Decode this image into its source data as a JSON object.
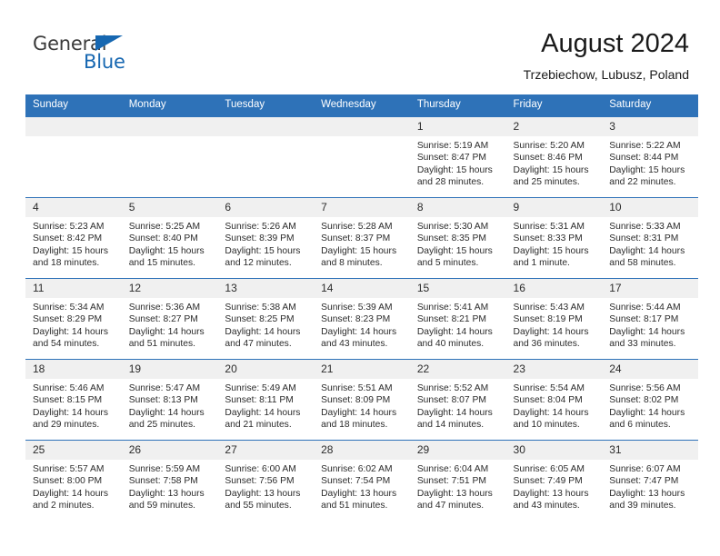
{
  "logo": {
    "word1": "General",
    "word2": "Blue",
    "triangle_color": "#1667b1"
  },
  "header": {
    "title": "August 2024",
    "subtitle": "Trzebiechow, Lubusz, Poland"
  },
  "colors": {
    "header_blue": "#2e72b8",
    "daynum_band": "#f0f0f0",
    "text": "#2b2b2b"
  },
  "weekday_headers": [
    "Sunday",
    "Monday",
    "Tuesday",
    "Wednesday",
    "Thursday",
    "Friday",
    "Saturday"
  ],
  "weeks": [
    [
      {
        "day": "",
        "sunrise": "",
        "sunset": "",
        "daylight": "",
        "empty": true
      },
      {
        "day": "",
        "sunrise": "",
        "sunset": "",
        "daylight": "",
        "empty": true
      },
      {
        "day": "",
        "sunrise": "",
        "sunset": "",
        "daylight": "",
        "empty": true
      },
      {
        "day": "",
        "sunrise": "",
        "sunset": "",
        "daylight": "",
        "empty": true
      },
      {
        "day": "1",
        "sunrise": "Sunrise: 5:19 AM",
        "sunset": "Sunset: 8:47 PM",
        "daylight": "Daylight: 15 hours and 28 minutes.",
        "empty": false
      },
      {
        "day": "2",
        "sunrise": "Sunrise: 5:20 AM",
        "sunset": "Sunset: 8:46 PM",
        "daylight": "Daylight: 15 hours and 25 minutes.",
        "empty": false
      },
      {
        "day": "3",
        "sunrise": "Sunrise: 5:22 AM",
        "sunset": "Sunset: 8:44 PM",
        "daylight": "Daylight: 15 hours and 22 minutes.",
        "empty": false
      }
    ],
    [
      {
        "day": "4",
        "sunrise": "Sunrise: 5:23 AM",
        "sunset": "Sunset: 8:42 PM",
        "daylight": "Daylight: 15 hours and 18 minutes.",
        "empty": false
      },
      {
        "day": "5",
        "sunrise": "Sunrise: 5:25 AM",
        "sunset": "Sunset: 8:40 PM",
        "daylight": "Daylight: 15 hours and 15 minutes.",
        "empty": false
      },
      {
        "day": "6",
        "sunrise": "Sunrise: 5:26 AM",
        "sunset": "Sunset: 8:39 PM",
        "daylight": "Daylight: 15 hours and 12 minutes.",
        "empty": false
      },
      {
        "day": "7",
        "sunrise": "Sunrise: 5:28 AM",
        "sunset": "Sunset: 8:37 PM",
        "daylight": "Daylight: 15 hours and 8 minutes.",
        "empty": false
      },
      {
        "day": "8",
        "sunrise": "Sunrise: 5:30 AM",
        "sunset": "Sunset: 8:35 PM",
        "daylight": "Daylight: 15 hours and 5 minutes.",
        "empty": false
      },
      {
        "day": "9",
        "sunrise": "Sunrise: 5:31 AM",
        "sunset": "Sunset: 8:33 PM",
        "daylight": "Daylight: 15 hours and 1 minute.",
        "empty": false
      },
      {
        "day": "10",
        "sunrise": "Sunrise: 5:33 AM",
        "sunset": "Sunset: 8:31 PM",
        "daylight": "Daylight: 14 hours and 58 minutes.",
        "empty": false
      }
    ],
    [
      {
        "day": "11",
        "sunrise": "Sunrise: 5:34 AM",
        "sunset": "Sunset: 8:29 PM",
        "daylight": "Daylight: 14 hours and 54 minutes.",
        "empty": false
      },
      {
        "day": "12",
        "sunrise": "Sunrise: 5:36 AM",
        "sunset": "Sunset: 8:27 PM",
        "daylight": "Daylight: 14 hours and 51 minutes.",
        "empty": false
      },
      {
        "day": "13",
        "sunrise": "Sunrise: 5:38 AM",
        "sunset": "Sunset: 8:25 PM",
        "daylight": "Daylight: 14 hours and 47 minutes.",
        "empty": false
      },
      {
        "day": "14",
        "sunrise": "Sunrise: 5:39 AM",
        "sunset": "Sunset: 8:23 PM",
        "daylight": "Daylight: 14 hours and 43 minutes.",
        "empty": false
      },
      {
        "day": "15",
        "sunrise": "Sunrise: 5:41 AM",
        "sunset": "Sunset: 8:21 PM",
        "daylight": "Daylight: 14 hours and 40 minutes.",
        "empty": false
      },
      {
        "day": "16",
        "sunrise": "Sunrise: 5:43 AM",
        "sunset": "Sunset: 8:19 PM",
        "daylight": "Daylight: 14 hours and 36 minutes.",
        "empty": false
      },
      {
        "day": "17",
        "sunrise": "Sunrise: 5:44 AM",
        "sunset": "Sunset: 8:17 PM",
        "daylight": "Daylight: 14 hours and 33 minutes.",
        "empty": false
      }
    ],
    [
      {
        "day": "18",
        "sunrise": "Sunrise: 5:46 AM",
        "sunset": "Sunset: 8:15 PM",
        "daylight": "Daylight: 14 hours and 29 minutes.",
        "empty": false
      },
      {
        "day": "19",
        "sunrise": "Sunrise: 5:47 AM",
        "sunset": "Sunset: 8:13 PM",
        "daylight": "Daylight: 14 hours and 25 minutes.",
        "empty": false
      },
      {
        "day": "20",
        "sunrise": "Sunrise: 5:49 AM",
        "sunset": "Sunset: 8:11 PM",
        "daylight": "Daylight: 14 hours and 21 minutes.",
        "empty": false
      },
      {
        "day": "21",
        "sunrise": "Sunrise: 5:51 AM",
        "sunset": "Sunset: 8:09 PM",
        "daylight": "Daylight: 14 hours and 18 minutes.",
        "empty": false
      },
      {
        "day": "22",
        "sunrise": "Sunrise: 5:52 AM",
        "sunset": "Sunset: 8:07 PM",
        "daylight": "Daylight: 14 hours and 14 minutes.",
        "empty": false
      },
      {
        "day": "23",
        "sunrise": "Sunrise: 5:54 AM",
        "sunset": "Sunset: 8:04 PM",
        "daylight": "Daylight: 14 hours and 10 minutes.",
        "empty": false
      },
      {
        "day": "24",
        "sunrise": "Sunrise: 5:56 AM",
        "sunset": "Sunset: 8:02 PM",
        "daylight": "Daylight: 14 hours and 6 minutes.",
        "empty": false
      }
    ],
    [
      {
        "day": "25",
        "sunrise": "Sunrise: 5:57 AM",
        "sunset": "Sunset: 8:00 PM",
        "daylight": "Daylight: 14 hours and 2 minutes.",
        "empty": false
      },
      {
        "day": "26",
        "sunrise": "Sunrise: 5:59 AM",
        "sunset": "Sunset: 7:58 PM",
        "daylight": "Daylight: 13 hours and 59 minutes.",
        "empty": false
      },
      {
        "day": "27",
        "sunrise": "Sunrise: 6:00 AM",
        "sunset": "Sunset: 7:56 PM",
        "daylight": "Daylight: 13 hours and 55 minutes.",
        "empty": false
      },
      {
        "day": "28",
        "sunrise": "Sunrise: 6:02 AM",
        "sunset": "Sunset: 7:54 PM",
        "daylight": "Daylight: 13 hours and 51 minutes.",
        "empty": false
      },
      {
        "day": "29",
        "sunrise": "Sunrise: 6:04 AM",
        "sunset": "Sunset: 7:51 PM",
        "daylight": "Daylight: 13 hours and 47 minutes.",
        "empty": false
      },
      {
        "day": "30",
        "sunrise": "Sunrise: 6:05 AM",
        "sunset": "Sunset: 7:49 PM",
        "daylight": "Daylight: 13 hours and 43 minutes.",
        "empty": false
      },
      {
        "day": "31",
        "sunrise": "Sunrise: 6:07 AM",
        "sunset": "Sunset: 7:47 PM",
        "daylight": "Daylight: 13 hours and 39 minutes.",
        "empty": false
      }
    ]
  ]
}
